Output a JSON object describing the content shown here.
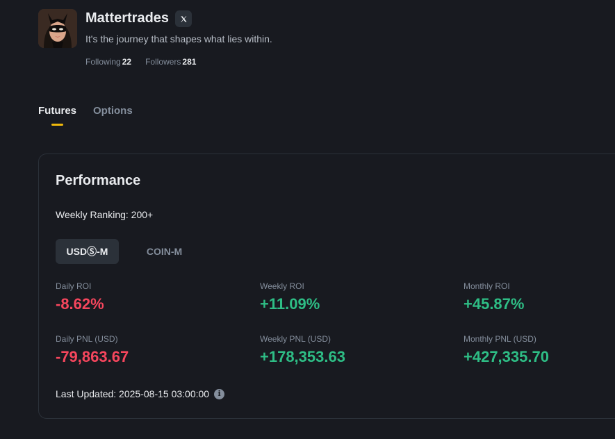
{
  "profile": {
    "name": "Mattertrades",
    "bio": "It's the journey that shapes what lies within.",
    "following_label": "Following",
    "following_value": "22",
    "followers_label": "Followers",
    "followers_value": "281",
    "avatar_icon": "masked-woman-avatar",
    "social_icon": "x-logo-icon"
  },
  "tabs": [
    {
      "label": "Futures",
      "active": true
    },
    {
      "label": "Options",
      "active": false
    }
  ],
  "performance": {
    "title": "Performance",
    "ranking": "Weekly Ranking: 200+",
    "segments": [
      {
        "label": "USDⓈ-M",
        "active": true
      },
      {
        "label": "COIN-M",
        "active": false
      }
    ],
    "metrics": [
      {
        "label": "Daily ROI",
        "value": "-8.62%",
        "trend": "negative"
      },
      {
        "label": "Weekly ROI",
        "value": "+11.09%",
        "trend": "positive"
      },
      {
        "label": "Monthly ROI",
        "value": "+45.87%",
        "trend": "positive"
      },
      {
        "label": "Daily PNL (USD)",
        "value": "-79,863.67",
        "trend": "negative"
      },
      {
        "label": "Weekly PNL (USD)",
        "value": "+178,353.63",
        "trend": "positive"
      },
      {
        "label": "Monthly PNL (USD)",
        "value": "+427,335.70",
        "trend": "positive"
      }
    ],
    "last_updated": "Last Updated: 2025-08-15 03:00:00"
  },
  "colors": {
    "background": "#181a20",
    "accent": "#f0b90b",
    "positive": "#2ebd85",
    "negative": "#f6465d",
    "muted": "#848e9c"
  }
}
